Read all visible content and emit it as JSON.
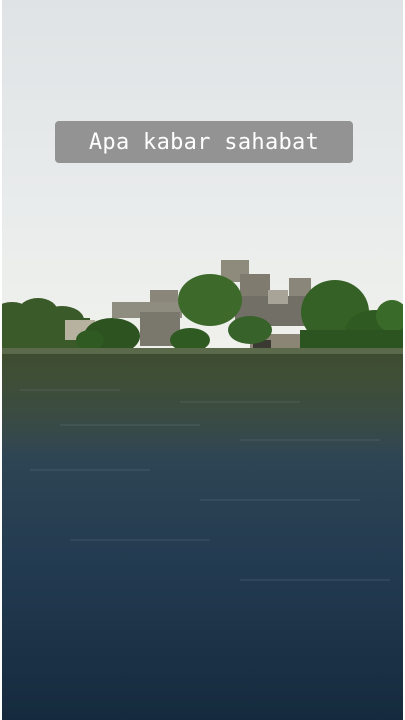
{
  "caption": {
    "text": "Apa kabar sahabat"
  },
  "scene": {
    "description_icon": "lake-landscape",
    "sky_color": "#e4e8ea",
    "water_color": "#223a4e",
    "tree_color": "#2f5a22",
    "building_color": "#8c8a7c"
  }
}
